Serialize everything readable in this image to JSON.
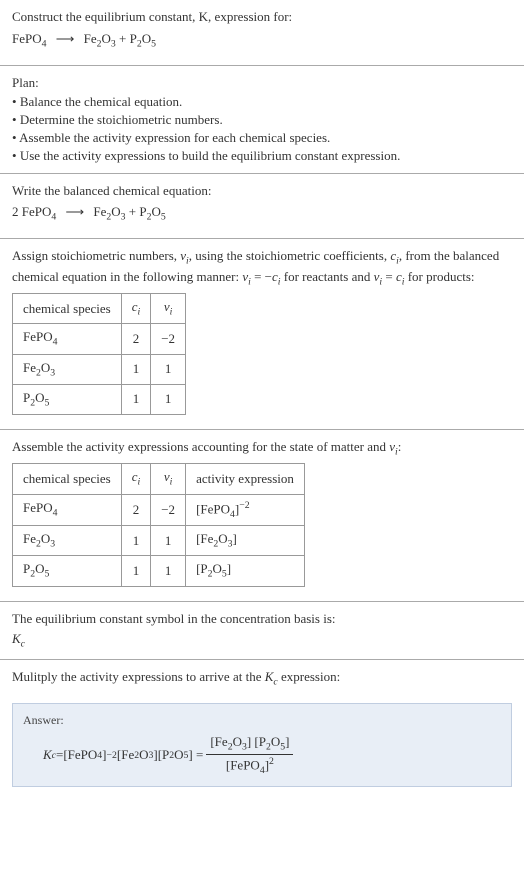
{
  "intro": {
    "construct": "Construct the equilibrium constant, K, expression for:",
    "eq1_lhs": "FePO",
    "eq1_lhs_sub": "4",
    "eq1_rhs1": "Fe",
    "eq1_rhs1_sub1": "2",
    "eq1_rhs1_mid": "O",
    "eq1_rhs1_sub2": "3",
    "eq1_plus": " + P",
    "eq1_rhs2_sub1": "2",
    "eq1_rhs2_mid": "O",
    "eq1_rhs2_sub2": "5"
  },
  "plan": {
    "title": "Plan:",
    "items": [
      "Balance the chemical equation.",
      "Determine the stoichiometric numbers.",
      "Assemble the activity expression for each chemical species.",
      "Use the activity expressions to build the equilibrium constant expression."
    ]
  },
  "balanced": {
    "text": "Write the balanced chemical equation:",
    "coef": "2 FePO",
    "sub1": "4",
    "rhs1": "Fe",
    "rhs1_sub1": "2",
    "rhs1_mid": "O",
    "rhs1_sub2": "3",
    "plus": " + P",
    "rhs2_sub1": "2",
    "rhs2_mid": "O",
    "rhs2_sub2": "5"
  },
  "assign": {
    "text1": "Assign stoichiometric numbers, ",
    "nu": "ν",
    "sub_i": "i",
    "text2": ", using the stoichiometric coefficients, ",
    "c": "c",
    "text3": ", from the balanced chemical equation in the following manner: ",
    "eq_neg": " = −",
    "text4": " for reactants and ",
    "eq_pos": " = ",
    "text5": " for products:"
  },
  "table1": {
    "h1": "chemical species",
    "h2": "c",
    "h2_sub": "i",
    "h3": "ν",
    "h3_sub": "i",
    "rows": [
      {
        "species_a": "FePO",
        "species_sub": "4",
        "species_b": "",
        "c": "2",
        "nu": "−2"
      },
      {
        "species_a": "Fe",
        "species_sub": "2",
        "species_b": "O",
        "species_sub2": "3",
        "c": "1",
        "nu": "1"
      },
      {
        "species_a": "P",
        "species_sub": "2",
        "species_b": "O",
        "species_sub2": "5",
        "c": "1",
        "nu": "1"
      }
    ]
  },
  "assemble": {
    "text": "Assemble the activity expressions accounting for the state of matter and ",
    "nu": "ν",
    "sub_i": "i",
    "colon": ":"
  },
  "table2": {
    "h1": "chemical species",
    "h2": "c",
    "h2_sub": "i",
    "h3": "ν",
    "h3_sub": "i",
    "h4": "activity expression",
    "rows": [
      {
        "species_a": "FePO",
        "species_sub": "4",
        "c": "2",
        "nu": "−2",
        "act_a": "[FePO",
        "act_sub": "4",
        "act_b": "]",
        "act_sup": "−2"
      },
      {
        "species_a": "Fe",
        "species_sub": "2",
        "species_b": "O",
        "species_sub2": "3",
        "c": "1",
        "nu": "1",
        "act_a": "[Fe",
        "act_sub": "2",
        "act_mid": "O",
        "act_sub2": "3",
        "act_b": "]"
      },
      {
        "species_a": "P",
        "species_sub": "2",
        "species_b": "O",
        "species_sub2": "5",
        "c": "1",
        "nu": "1",
        "act_a": "[P",
        "act_sub": "2",
        "act_mid": "O",
        "act_sub2": "5",
        "act_b": "]"
      }
    ]
  },
  "eq_symbol": {
    "text": "The equilibrium constant symbol in the concentration basis is:",
    "K": "K",
    "sub": "c"
  },
  "multiply": {
    "text1": "Mulitply the activity expressions to arrive at the ",
    "K": "K",
    "sub": "c",
    "text2": " expression:"
  },
  "answer": {
    "label": "Answer:",
    "K": "K",
    "sub": "c",
    "eq": " = ",
    "t1": "[FePO",
    "t1_sub": "4",
    "t1_close": "]",
    "t1_sup": "−2",
    "sp": " ",
    "t2": "[Fe",
    "t2_sub": "2",
    "t2_mid": "O",
    "t2_sub2": "3",
    "t2_close": "] ",
    "t3": "[P",
    "t3_sub": "2",
    "t3_mid": "O",
    "t3_sub2": "5",
    "t3_close": "] = ",
    "num_a": "[Fe",
    "num_sub1": "2",
    "num_mid1": "O",
    "num_sub2": "3",
    "num_close1": "] [P",
    "num_sub3": "2",
    "num_mid2": "O",
    "num_sub4": "5",
    "num_close2": "]",
    "den_a": "[FePO",
    "den_sub": "4",
    "den_close": "]",
    "den_sup": "2"
  }
}
